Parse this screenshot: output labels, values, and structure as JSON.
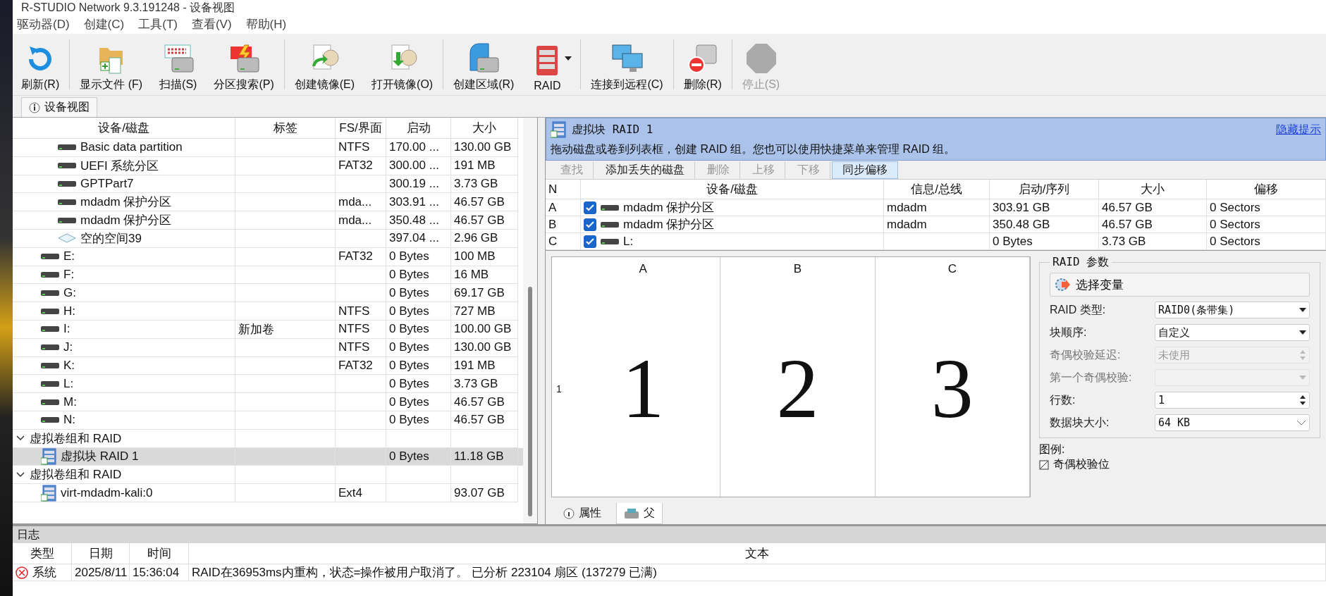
{
  "window": {
    "title": "R-STUDIO Network 9.3.191248 - 设备视图"
  },
  "menu": [
    "驱动器(D)",
    "创建(C)",
    "工具(T)",
    "查看(V)",
    "帮助(H)"
  ],
  "toolbar": [
    {
      "label": "刷新(R)",
      "kind": "refresh",
      "disabled": false,
      "dropdown": false
    },
    {
      "label": "显示文件 (F)",
      "kind": "files",
      "disabled": false,
      "dropdown": false
    },
    {
      "label": "扫描(S)",
      "kind": "scan",
      "disabled": false,
      "dropdown": false
    },
    {
      "label": "分区搜索(P)",
      "kind": "search",
      "disabled": false,
      "dropdown": false
    },
    {
      "label": "创建镜像(E)",
      "kind": "image-create",
      "disabled": false,
      "dropdown": false
    },
    {
      "label": "打开镜像(O)",
      "kind": "image-open",
      "disabled": false,
      "dropdown": false
    },
    {
      "label": "创建区域(R)",
      "kind": "region",
      "disabled": false,
      "dropdown": false
    },
    {
      "label": "RAID",
      "kind": "raid",
      "disabled": false,
      "dropdown": true
    },
    {
      "label": "连接到远程(C)",
      "kind": "connect",
      "disabled": false,
      "dropdown": false
    },
    {
      "label": "删除(R)",
      "kind": "delete",
      "disabled": false,
      "dropdown": false
    },
    {
      "label": "停止(S)",
      "kind": "stop",
      "disabled": true,
      "dropdown": false
    }
  ],
  "view_tab": {
    "label": "设备视图"
  },
  "tree": {
    "columns": [
      "设备/磁盘",
      "标签",
      "FS/界面",
      "启动",
      "大小"
    ],
    "items": [
      {
        "kind": "container",
        "children": [
          {
            "kind": "container",
            "children": [
              {
                "kind": "partition",
                "name": "Basic data partition",
                "fs": "NTFS",
                "start": "170.00 ...",
                "size": "130.00 GB",
                "selected": false
              },
              {
                "kind": "partition",
                "name": "UEFI 系统分区",
                "fs": "FAT32",
                "start": "300.00 ...",
                "size": "191 MB",
                "selected": false
              },
              {
                "kind": "partition",
                "name": "GPTPart7",
                "start": "300.19 ...",
                "size": "3.73 GB",
                "selected": false
              },
              {
                "kind": "partition",
                "name": "mdadm 保护分区",
                "fs": "mda...",
                "start": "303.91 ...",
                "size": "46.57 GB",
                "selected": false
              },
              {
                "kind": "partition",
                "name": "mdadm 保护分区",
                "fs": "mda...",
                "start": "350.48 ...",
                "size": "46.57 GB",
                "selected": false
              },
              {
                "kind": "free",
                "name": "空的空间39",
                "start": "397.04 ...",
                "size": "2.96 GB",
                "selected": false
              }
            ]
          },
          {
            "kind": "partition",
            "name": "E:",
            "fs": "FAT32",
            "start": "0 Bytes",
            "size": "100 MB",
            "selected": false
          },
          {
            "kind": "partition",
            "name": "F:",
            "start": "0 Bytes",
            "size": "16 MB",
            "selected": false
          },
          {
            "kind": "partition",
            "name": "G:",
            "start": "0 Bytes",
            "size": "69.17 GB",
            "selected": false
          },
          {
            "kind": "partition",
            "name": "H:",
            "fs": "NTFS",
            "start": "0 Bytes",
            "size": "727 MB",
            "selected": false
          },
          {
            "kind": "partition",
            "name": "I:",
            "label": "新加卷",
            "fs": "NTFS",
            "start": "0 Bytes",
            "size": "100.00 GB",
            "selected": false
          },
          {
            "kind": "partition",
            "name": "J:",
            "fs": "NTFS",
            "start": "0 Bytes",
            "size": "130.00 GB",
            "selected": false
          },
          {
            "kind": "partition",
            "name": "K:",
            "fs": "FAT32",
            "start": "0 Bytes",
            "size": "191 MB",
            "selected": false
          },
          {
            "kind": "partition",
            "name": "L:",
            "start": "0 Bytes",
            "size": "3.73 GB",
            "selected": false
          },
          {
            "kind": "partition",
            "name": "M:",
            "start": "0 Bytes",
            "size": "46.57 GB",
            "selected": false
          },
          {
            "kind": "partition",
            "name": "N:",
            "start": "0 Bytes",
            "size": "46.57 GB",
            "selected": false
          }
        ]
      },
      {
        "kind": "group",
        "name": "虚拟卷组和 RAID",
        "expanded": true,
        "selected": false,
        "children": [
          {
            "kind": "raid",
            "name": "虚拟块 RAID 1",
            "start": "0 Bytes",
            "size": "11.18 GB",
            "selected": true
          }
        ]
      },
      {
        "kind": "group",
        "name": "虚拟卷组和 RAID",
        "expanded": true,
        "selected": false,
        "children": [
          {
            "kind": "raid",
            "name": "virt-mdadm-kali:0",
            "fs": "Ext4",
            "size": "93.07 GB",
            "selected": false
          }
        ]
      }
    ]
  },
  "raid_panel": {
    "title": "虚拟块 RAID 1",
    "hide_link": "隐藏提示",
    "hint": "拖动磁盘或卷到列表框，创建 RAID 组。您也可以使用快捷菜单来管理 RAID 组。",
    "actions": [
      {
        "label": "查找",
        "disabled": true,
        "selected": false
      },
      {
        "label": "添加丢失的磁盘",
        "disabled": false,
        "selected": false
      },
      {
        "label": "删除",
        "disabled": true,
        "selected": false
      },
      {
        "label": "上移",
        "disabled": true,
        "selected": false
      },
      {
        "label": "下移",
        "disabled": true,
        "selected": false
      },
      {
        "label": "同步偏移",
        "disabled": false,
        "selected": true
      }
    ],
    "columns": [
      "N",
      "设备/磁盘",
      "信息/总线",
      "启动/序列",
      "大小",
      "偏移"
    ],
    "members": [
      {
        "n": "A",
        "name": "mdadm 保护分区",
        "checked": true,
        "info": "mdadm",
        "start": "303.91 GB",
        "size": "46.57 GB",
        "offset": "0 Sectors"
      },
      {
        "n": "B",
        "name": "mdadm 保护分区",
        "checked": true,
        "info": "mdadm",
        "start": "350.48 GB",
        "size": "46.57 GB",
        "offset": "0 Sectors"
      },
      {
        "n": "C",
        "name": "L:",
        "checked": true,
        "start": "0 Bytes",
        "size": "3.73 GB",
        "offset": "0 Sectors"
      }
    ],
    "layout": {
      "columns": [
        "A",
        "B",
        "C"
      ],
      "rows": [
        {
          "label": "1",
          "blocks": [
            "1",
            "2",
            "3"
          ]
        }
      ]
    },
    "params": {
      "title": "RAID 参数",
      "variant_button": "选择变量",
      "fields": [
        {
          "label": "RAID 类型:",
          "kind": "select",
          "value": "RAID0(条带集)",
          "disabled": false
        },
        {
          "label": "块顺序:",
          "kind": "select",
          "value": "自定义",
          "disabled": false
        },
        {
          "label": "奇偶校验延迟:",
          "kind": "spin",
          "value": "未使用",
          "disabled": true
        },
        {
          "label": "第一个奇偶校验:",
          "kind": "select",
          "disabled": true
        },
        {
          "label": "行数:",
          "kind": "spin",
          "value": "1",
          "disabled": false
        },
        {
          "label": "数据块大小:",
          "kind": "combo",
          "value": "64 KB",
          "disabled": false
        }
      ]
    },
    "legend": {
      "title": "图例:",
      "items": [
        {
          "label": "奇偶校验位"
        }
      ]
    },
    "tabs": [
      {
        "label": "属性",
        "selected": false
      },
      {
        "label": "父",
        "selected": true
      }
    ]
  },
  "log": {
    "title": "日志",
    "columns": [
      "类型",
      "日期",
      "时间",
      "文本"
    ],
    "rows": [
      {
        "kind": "error",
        "type": "系统",
        "date": "2025/8/11",
        "time": "15:36:04",
        "text": "RAID在36953ms内重构，状态=操作被用户取消了。 已分析 223104 扇区 (137279 已满)"
      }
    ]
  }
}
